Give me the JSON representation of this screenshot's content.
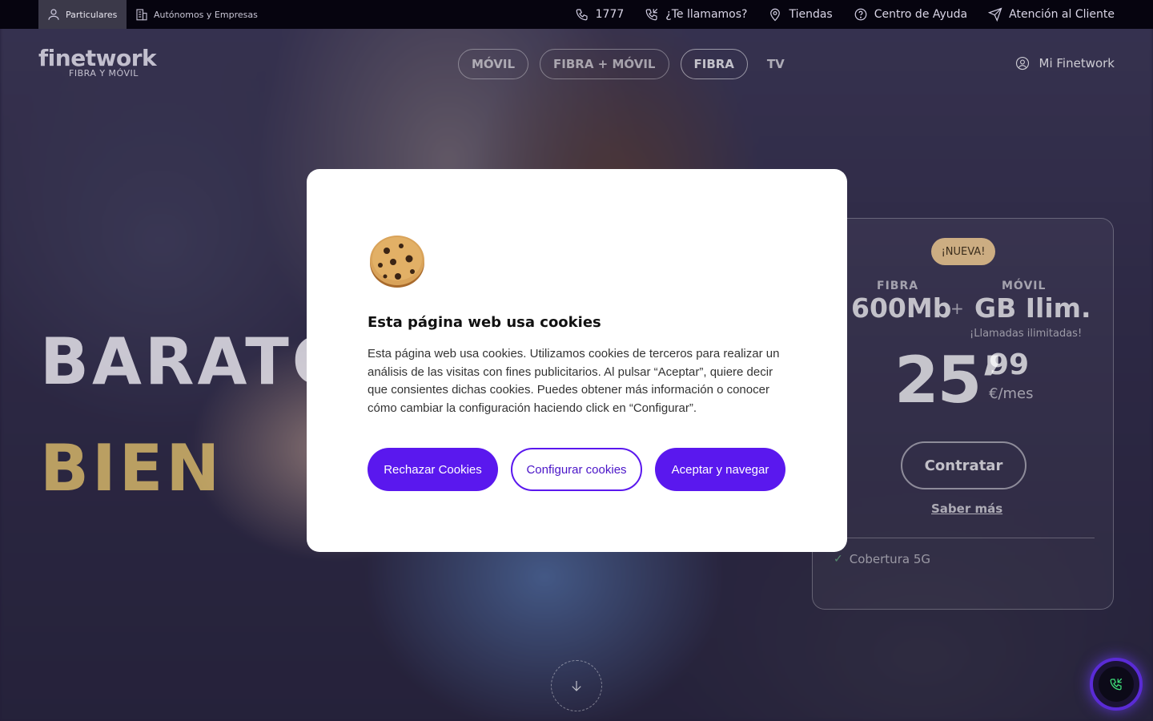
{
  "topbar": {
    "segments": [
      {
        "label": "Particulares",
        "icon": "user-icon"
      },
      {
        "label": "Autónomos y Empresas",
        "icon": "building-icon"
      }
    ],
    "links": [
      {
        "label": "1777",
        "icon": "phone-icon"
      },
      {
        "label": "¿Te llamamos?",
        "icon": "phone-callback-icon"
      },
      {
        "label": "Tiendas",
        "icon": "map-pin-icon"
      },
      {
        "label": "Centro de Ayuda",
        "icon": "help-circle-icon"
      },
      {
        "label": "Atención al Cliente",
        "icon": "send-icon"
      }
    ]
  },
  "header": {
    "logo": "finetwork",
    "logo_tagline": "FIBRA Y MÓVIL",
    "nav": [
      "MÓVIL",
      "FIBRA + MÓVIL",
      "FIBRA",
      "TV"
    ],
    "account_label": "Mi Finetwork"
  },
  "hero": {
    "line1": "BARATO",
    "line2": "BIEN"
  },
  "offer": {
    "badge": "¡NUEVA!",
    "fibra_label": "FIBRA",
    "fibra_value": "600Mb",
    "plus": "+",
    "movil_label": "MÓVIL",
    "movil_value": "GB Ilim.",
    "calls": "¡Llamadas ilimitadas!",
    "price_int": "25",
    "price_sep": "’",
    "price_dec": "99",
    "price_unit": "€/mes",
    "cta": "Contratar",
    "more": "Saber más",
    "feature": "Cobertura 5G"
  },
  "cookie_modal": {
    "title": "Esta página web usa cookies",
    "body": "Esta página web usa cookies. Utilizamos cookies de terceros para realizar un análisis de las visitas con fines publicitarios. Al pulsar “Aceptar”, quiere decir que consientes dichas cookies. Puedes obtener más información o conocer cómo cambiar la configuración haciendo click en “Configurar”.",
    "reject_label": "Rechazar Cookies",
    "configure_label": "Configurar cookies",
    "accept_label": "Aceptar y navegar"
  },
  "colors": {
    "primary": "#5a18ee",
    "topbar_bg": "#06040f",
    "accent_yellow": "#ebc86e"
  }
}
